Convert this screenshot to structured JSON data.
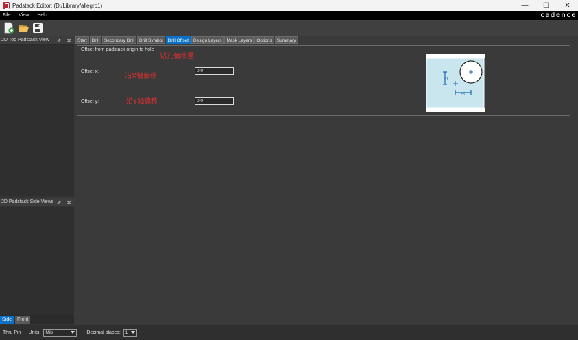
{
  "window": {
    "title": "Padstack Editor:  (D:/Library/allegro1)",
    "minimize": "—",
    "maximize": "☐",
    "close": "✕"
  },
  "menu": {
    "items": [
      "File",
      "View",
      "Help"
    ],
    "brand": "cadence"
  },
  "toolbar": {
    "new_icon": "new-file-icon",
    "open_icon": "open-folder-icon",
    "save_icon": "save-disk-icon"
  },
  "left_panels": {
    "top_view_title": "2D Top Padstack View",
    "side_view_title": "2D Padstack Side Views",
    "float_glyph": "⇗",
    "close_glyph": "✕",
    "bottom_tabs": [
      "Side",
      "Front"
    ]
  },
  "tabs": [
    "Start",
    "Drill",
    "Secondary Drill",
    "Drill Symbol",
    "Drill Offset",
    "Design Layers",
    "Mask Layers",
    "Options",
    "Summary"
  ],
  "active_tab": "Drill Offset",
  "drill_offset": {
    "section_title": "Offset from padstack origin to hole",
    "annotation_title": "钻孔偏移量",
    "offset_x_label": "Offset x:",
    "offset_x_value": "0.0",
    "offset_x_annotation": "沿X轴偏移",
    "offset_y_label": "Offset y:",
    "offset_y_value": "0.0",
    "offset_y_annotation": "沿Y轴偏移"
  },
  "diagram": {
    "y_marker": "+Y",
    "x_marker": "+X",
    "fill_color": "#c9e6ef",
    "arrow_color": "#1a66b8"
  },
  "status": {
    "pad_type": "Thru Pin",
    "units_label": "Units:",
    "units_value": "Mils",
    "decimal_label": "Decimal places:",
    "decimal_value": "1"
  }
}
